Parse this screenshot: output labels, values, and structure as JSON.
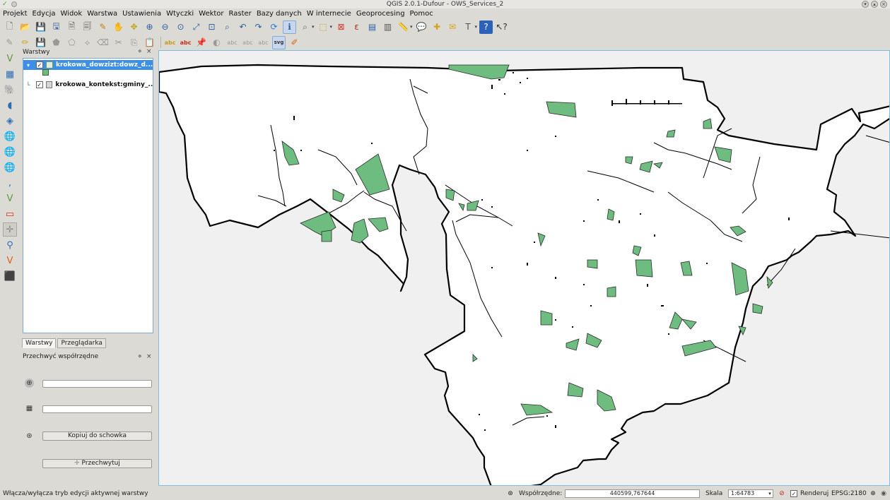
{
  "window": {
    "title": "QGIS 2.0.1-Dufour - OWS_Services_2"
  },
  "menu": [
    "Projekt",
    "Edycja",
    "Widok",
    "Warstwa",
    "Ustawienia",
    "Wtyczki",
    "Wektor",
    "Raster",
    "Bazy danych",
    "W internecie",
    "Geoprocesing",
    "Pomoc"
  ],
  "toolbar": {
    "row1_icons": [
      "new-project-icon",
      "open-project-icon",
      "save-project-icon",
      "save-as-icon",
      "new-print-composer-icon",
      "composer-manager-icon",
      "style-manager-icon",
      "pan-icon",
      "pan-to-selection-icon",
      "zoom-in-icon",
      "zoom-out-icon",
      "zoom-actual-icon",
      "zoom-full-icon",
      "zoom-selection-icon",
      "zoom-layer-icon",
      "zoom-last-icon",
      "zoom-next-icon",
      "refresh-icon",
      "identify-icon",
      "zoom-dropdown-icon",
      "select-features-icon",
      "deselect-icon",
      "field-calculator-icon",
      "attribute-table-icon",
      "statistics-icon",
      "measure-icon",
      "map-tips-icon",
      "new-bookmark-icon",
      "show-bookmarks-icon",
      "text-annotation-icon",
      "help-icon",
      "whats-this-icon"
    ],
    "row2_icons": [
      "current-edits-icon",
      "toggle-editing-icon",
      "save-edits-icon",
      "add-feature-icon",
      "move-feature-icon",
      "node-tool-icon",
      "delete-selected-icon",
      "cut-features-icon",
      "copy-features-icon",
      "paste-features-icon",
      "label-toolbar-icon",
      "layer-labeling-icon",
      "pin-labels-icon",
      "show-hide-labels-icon",
      "move-label-icon",
      "rotate-label-icon",
      "change-label-icon",
      "svg-annotation-icon",
      "edit-python-icon"
    ]
  },
  "layers_panel": {
    "title": "Warstwy",
    "layers": [
      {
        "name": "krokowa_dowzizt:dowz_d...",
        "checked": true,
        "selected": true,
        "color": "#6ebc7f"
      },
      {
        "name": "krokowa_kontekst:gminy_...",
        "checked": true,
        "selected": false
      }
    ]
  },
  "tabs": [
    "Warstwy",
    "Przeglądarka"
  ],
  "coord_capture": {
    "title": "Przechwyć współrzędne",
    "field1": "",
    "field2": "",
    "copy_label": "Kopiuj do schowka",
    "capture_label": "Przechwytuj"
  },
  "status": {
    "message": "Włącza/wyłącza tryb edycji aktywnej warstwy",
    "coord_label": "Współrzędne:",
    "coord_value": "440599,767644",
    "scale_label": "Skala",
    "scale_value": "1:64783",
    "render_label": "Renderuj",
    "crs": "EPSG:2180"
  },
  "colors": {
    "polygon_fill": "#6ebc7f",
    "selection": "#3d8ee6",
    "canvas_frame": "#7ebfe0"
  }
}
